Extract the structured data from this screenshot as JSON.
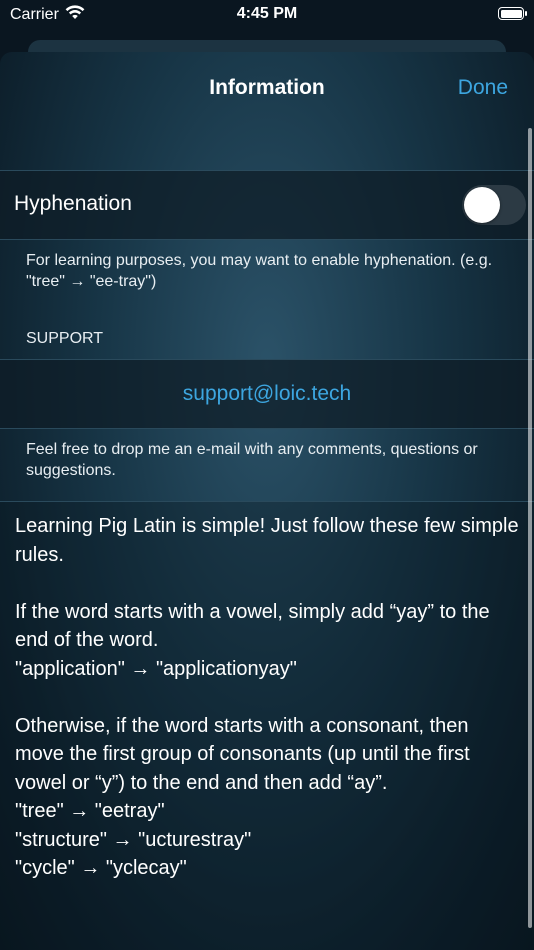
{
  "status_bar": {
    "carrier": "Carrier",
    "time": "4:45 PM",
    "battery_level": 1.0
  },
  "nav": {
    "title": "Information",
    "done_label": "Done"
  },
  "hyphenation": {
    "label": "Hyphenation",
    "enabled": false,
    "footer": "For learning purposes, you may want to enable hyphenation. (e.g. \"tree\" → \"ee-tray\")"
  },
  "support": {
    "header": "SUPPORT",
    "email": "support@loic.tech",
    "footer": "Feel free to drop me an e-mail with any comments, questions or suggestions."
  },
  "rules": {
    "text": "Learning Pig Latin is simple! Just follow these few simple rules.\n\nIf the word starts with a vowel, simply add “yay” to the end of the word.\n\"application\" → \"applicationyay\"\n\nOtherwise, if the word starts with a consonant, then move the first group of consonants (up until the first vowel or “y”) to the end and then add “ay”.\n\"tree\" → \"eetray\"\n\"structure\" → \"ucturestray\"\n\"cycle\" → \"yclecay\""
  },
  "colors": {
    "accent": "#3da6e0",
    "background": "#0d1f2b"
  }
}
